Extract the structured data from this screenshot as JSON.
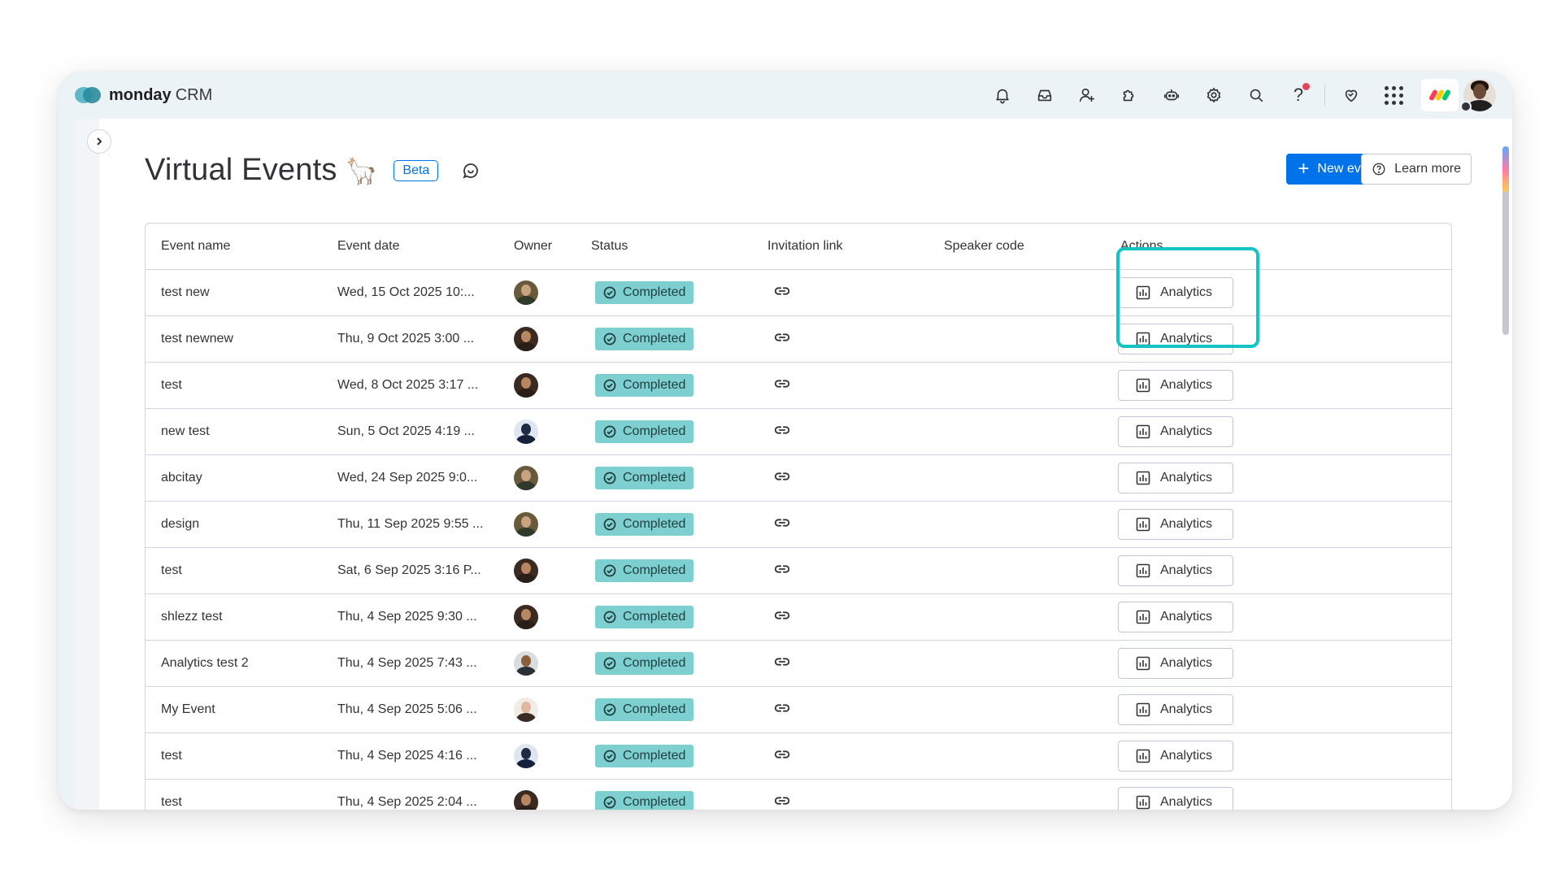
{
  "app": {
    "brand": "monday",
    "product": "CRM"
  },
  "page": {
    "title": "Virtual Events",
    "title_emoji": "🦙",
    "badge": "Beta",
    "new_event_label": "New event",
    "learn_more_label": "Learn more"
  },
  "topbar": {
    "help_label": "?"
  },
  "table": {
    "columns": [
      "Event name",
      "Event date",
      "Owner",
      "Status",
      "Invitation link",
      "Speaker code",
      "Actions"
    ],
    "rows": [
      {
        "name": "test new",
        "date": "Wed, 15 Oct 2025 10:...",
        "status": "Completed",
        "action": "Analytics",
        "avatar": "a1"
      },
      {
        "name": "test newnew",
        "date": "Thu, 9 Oct 2025 3:00 ...",
        "status": "Completed",
        "action": "Analytics",
        "avatar": "a2"
      },
      {
        "name": "test",
        "date": "Wed, 8 Oct 2025 3:17 ...",
        "status": "Completed",
        "action": "Analytics",
        "avatar": "a2"
      },
      {
        "name": "new test",
        "date": "Sun, 5 Oct 2025 4:19 ...",
        "status": "Completed",
        "action": "Analytics",
        "avatar": "a3"
      },
      {
        "name": "abcitay",
        "date": "Wed, 24 Sep 2025 9:0...",
        "status": "Completed",
        "action": "Analytics",
        "avatar": "a1"
      },
      {
        "name": "design",
        "date": "Thu, 11 Sep 2025 9:55 ...",
        "status": "Completed",
        "action": "Analytics",
        "avatar": "a1"
      },
      {
        "name": "test",
        "date": "Sat, 6 Sep 2025 3:16 P...",
        "status": "Completed",
        "action": "Analytics",
        "avatar": "a2"
      },
      {
        "name": "shlezz test",
        "date": "Thu, 4 Sep 2025 9:30 ...",
        "status": "Completed",
        "action": "Analytics",
        "avatar": "a2"
      },
      {
        "name": "Analytics test 2",
        "date": "Thu, 4 Sep 2025 7:43 ...",
        "status": "Completed",
        "action": "Analytics",
        "avatar": "a4"
      },
      {
        "name": "My Event",
        "date": "Thu, 4 Sep 2025 5:06 ...",
        "status": "Completed",
        "action": "Analytics",
        "avatar": "a5"
      },
      {
        "name": "test",
        "date": "Thu, 4 Sep 2025 4:16 ...",
        "status": "Completed",
        "action": "Analytics",
        "avatar": "a3"
      },
      {
        "name": "test",
        "date": "Thu, 4 Sep 2025 2:04 ...",
        "status": "Completed",
        "action": "Analytics",
        "avatar": "a2"
      }
    ]
  },
  "colors": {
    "primary": "#0073ea",
    "status_completed": "#7ecfd0",
    "highlight": "#12c4c4",
    "frame": "#ecf3f7"
  },
  "icons": [
    "bell-icon",
    "inbox-icon",
    "invite-user-icon",
    "puzzle-icon",
    "robot-icon",
    "gear-icon",
    "search-icon",
    "help-icon",
    "heart-icon",
    "apps-grid-icon",
    "chevron-right-icon",
    "feedback-icon",
    "plus-icon",
    "help-circle-icon",
    "check-circle-icon",
    "link-icon",
    "chart-icon"
  ]
}
